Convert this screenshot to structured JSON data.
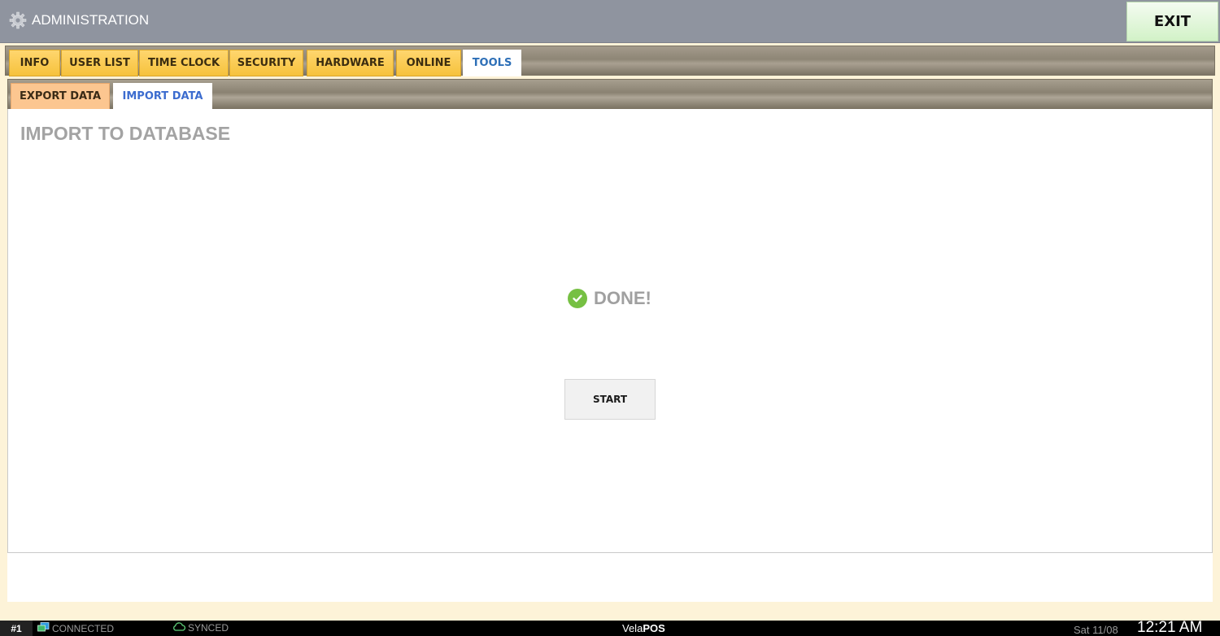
{
  "titlebar": {
    "title": "ADMINISTRATION",
    "icon": "gear-icon",
    "exit_label": "EXIT"
  },
  "tabs": [
    {
      "label": "INFO",
      "active": false
    },
    {
      "label": "USER LIST",
      "active": false
    },
    {
      "label": "TIME CLOCK",
      "active": false
    },
    {
      "label": "SECURITY",
      "active": false
    },
    {
      "label": "HARDWARE",
      "active": false
    },
    {
      "label": "ONLINE",
      "active": false
    },
    {
      "label": "TOOLS",
      "active": true
    }
  ],
  "subtabs": [
    {
      "label": "EXPORT DATA",
      "active": false
    },
    {
      "label": "IMPORT DATA",
      "active": true
    }
  ],
  "main": {
    "section_title": "IMPORT TO DATABASE",
    "status_icon": "check-circle-icon",
    "status_text": "DONE!",
    "start_label": "START"
  },
  "statusbar": {
    "terminal": "#1",
    "connection": "CONNECTED",
    "sync": "SYNCED",
    "brand_prefix": "Vela",
    "brand_suffix": "POS",
    "date": "Sat 11/08",
    "time": "12:21 AM"
  },
  "colors": {
    "titlebar_bg": "#8f949f",
    "tab_bg": "#f6c23c",
    "subtab_bg": "#fcc690",
    "active_tab_text": "#2d6fb7",
    "success": "#76c043"
  }
}
